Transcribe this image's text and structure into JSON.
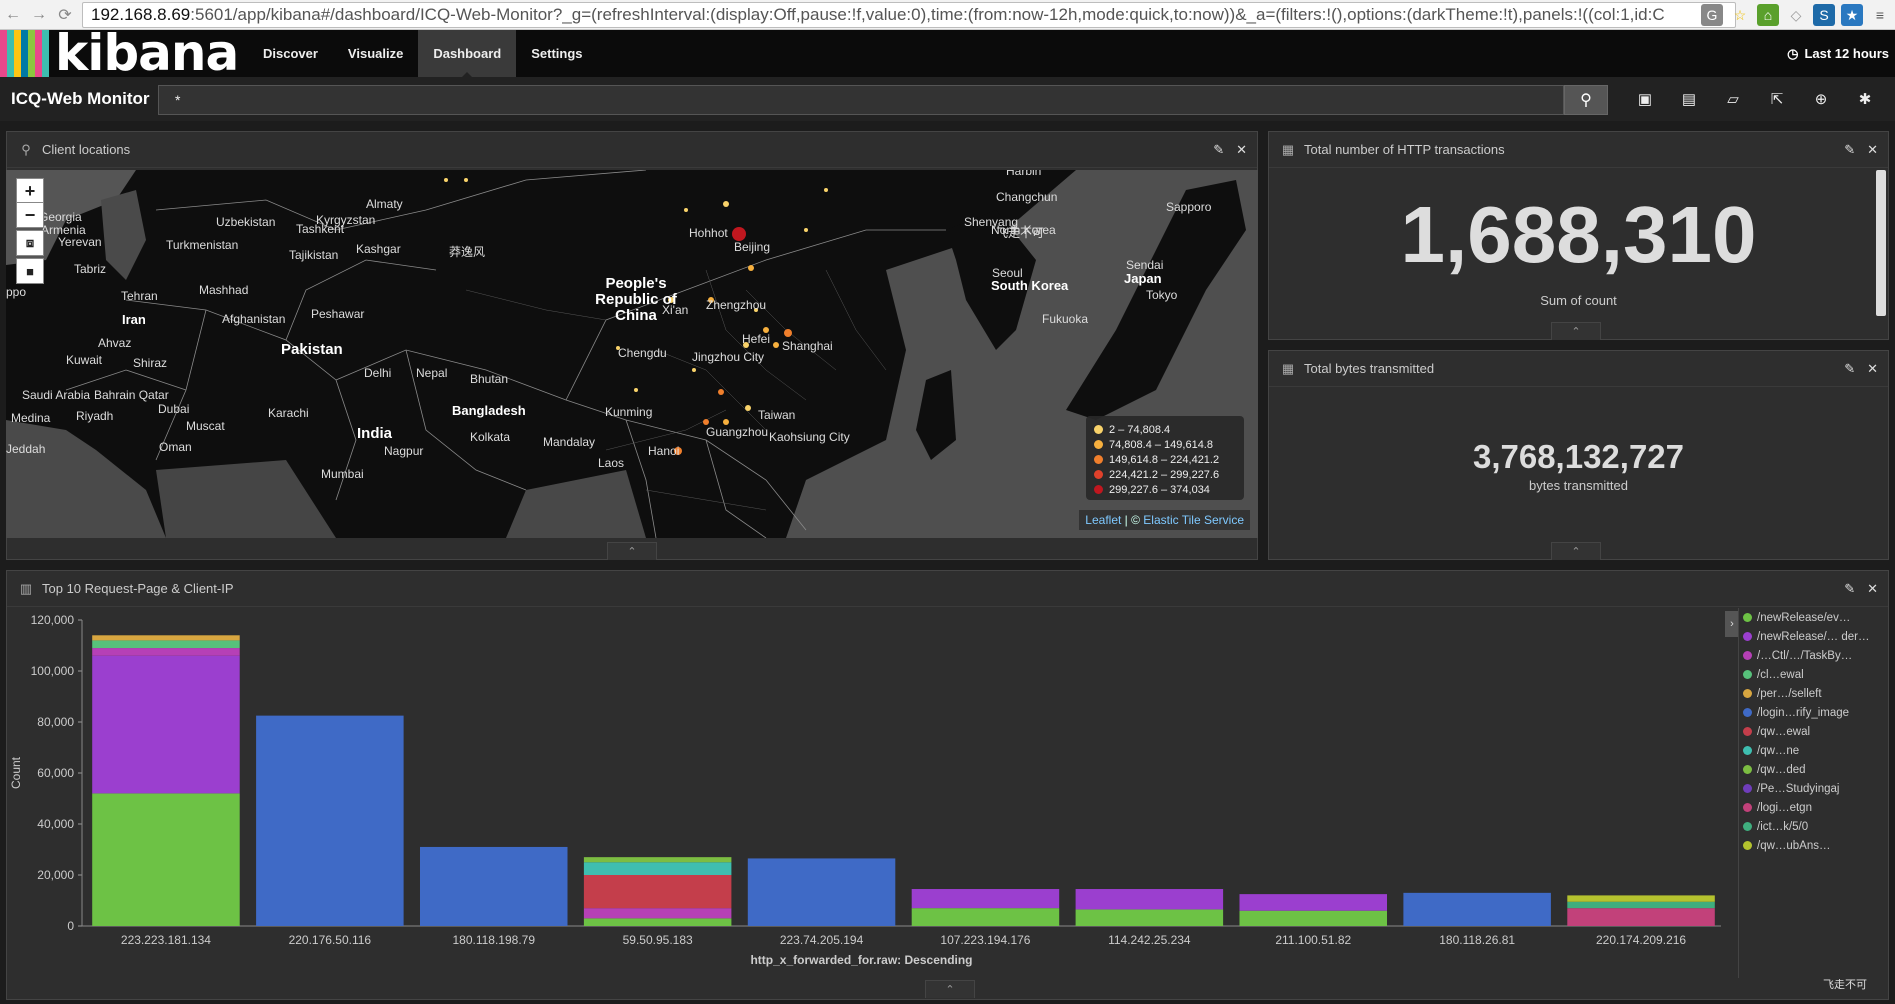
{
  "browser": {
    "url_host": "192.168.8.69",
    "url_rest": ":5601/app/kibana#/dashboard/ICQ-Web-Monitor?_g=(refreshInterval:(display:Off,pause:!f,value:0),time:(from:now-12h,mode:quick,to:now))&_a=(filters:!(),options:(darkTheme:!t),panels:!((col:1,id:C"
  },
  "nav": {
    "logo": "kibana",
    "logo_colors": [
      "#e8488b",
      "#3ebeb0",
      "#fec514",
      "#0079a5",
      "#8cc63f",
      "#e8488b",
      "#3ebeb0"
    ],
    "items": [
      {
        "label": "Discover"
      },
      {
        "label": "Visualize"
      },
      {
        "label": "Dashboard"
      },
      {
        "label": "Settings"
      }
    ],
    "active": "Dashboard",
    "time_range": "Last 12 hours"
  },
  "dashboard": {
    "title": "ICQ-Web Monitor",
    "query": "*"
  },
  "panels": {
    "map": {
      "title": "Client locations",
      "attribution_link": "Leaflet",
      "attribution_sep": " | © ",
      "attribution_service": "Elastic Tile Service",
      "legend": [
        {
          "label": "2 – 74,808.4",
          "color": "#f8d26a"
        },
        {
          "label": "74,808.4 – 149,614.8",
          "color": "#f7b03e"
        },
        {
          "label": "149,614.8 – 224,421.2",
          "color": "#f07f2c"
        },
        {
          "label": "224,421.2 – 299,227.6",
          "color": "#e0412b"
        },
        {
          "label": "299,227.6 – 374,034",
          "color": "#c0171f"
        }
      ],
      "places": [
        {
          "name": "Harbin",
          "cls": ""
        },
        {
          "name": "Almaty",
          "cls": ""
        },
        {
          "name": "Changchun",
          "cls": ""
        },
        {
          "name": "Georgia",
          "cls": ""
        },
        {
          "name": "Uzbekistan",
          "cls": ""
        },
        {
          "name": "Kyrgyzstan",
          "cls": ""
        },
        {
          "name": "Shenyang",
          "cls": ""
        },
        {
          "name": "Sapporo",
          "cls": ""
        },
        {
          "name": "Armenia",
          "cls": ""
        },
        {
          "name": "Tashkent",
          "cls": ""
        },
        {
          "name": "Hohhot",
          "cls": ""
        },
        {
          "name": "North Korea",
          "cls": ""
        },
        {
          "name": "Yerevan",
          "cls": ""
        },
        {
          "name": "Turkmenistan",
          "cls": ""
        },
        {
          "name": "Tajikistan",
          "cls": ""
        },
        {
          "name": "Kashgar",
          "cls": ""
        },
        {
          "name": "Beijing",
          "cls": ""
        },
        {
          "name": "飞走不可",
          "cls": ""
        },
        {
          "name": "Tabriz",
          "cls": ""
        },
        {
          "name": "Seoul",
          "cls": ""
        },
        {
          "name": "Sendai",
          "cls": ""
        },
        {
          "name": "People's Republic of China",
          "cls": "big"
        },
        {
          "name": "Japan",
          "cls": "mid"
        },
        {
          "name": "Tehran",
          "cls": ""
        },
        {
          "name": "Mashhad",
          "cls": ""
        },
        {
          "name": "South Korea",
          "cls": "mid"
        },
        {
          "name": "Tokyo",
          "cls": ""
        },
        {
          "name": "Zhengzhou",
          "cls": ""
        },
        {
          "name": "Iran",
          "cls": "mid"
        },
        {
          "name": "Afghanistan",
          "cls": ""
        },
        {
          "name": "Peshawar",
          "cls": ""
        },
        {
          "name": "Xi'an",
          "cls": ""
        },
        {
          "name": "Fukuoka",
          "cls": ""
        },
        {
          "name": "Hefei",
          "cls": ""
        },
        {
          "name": "Pakistan",
          "cls": "big"
        },
        {
          "name": "Shanghai",
          "cls": ""
        },
        {
          "name": "Kuwait",
          "cls": ""
        },
        {
          "name": "Ahvaz",
          "cls": ""
        },
        {
          "name": "Chengdu",
          "cls": ""
        },
        {
          "name": "Jingzhou City",
          "cls": ""
        },
        {
          "name": "Shiraz",
          "cls": ""
        },
        {
          "name": "Delhi",
          "cls": ""
        },
        {
          "name": "Nepal",
          "cls": ""
        },
        {
          "name": "Bhutan",
          "cls": ""
        },
        {
          "name": "Saudi Arabia",
          "cls": ""
        },
        {
          "name": "Bahrain Qatar",
          "cls": ""
        },
        {
          "name": "Kunming",
          "cls": ""
        },
        {
          "name": "Bangladesh",
          "cls": "mid"
        },
        {
          "name": "Taiwan",
          "cls": ""
        },
        {
          "name": "Medina",
          "cls": ""
        },
        {
          "name": "Riyadh",
          "cls": ""
        },
        {
          "name": "Dubai",
          "cls": ""
        },
        {
          "name": "Karachi",
          "cls": ""
        },
        {
          "name": "Muscat",
          "cls": ""
        },
        {
          "name": "India",
          "cls": "big"
        },
        {
          "name": "Guangzhou",
          "cls": ""
        },
        {
          "name": "Kaohsiung City",
          "cls": ""
        },
        {
          "name": "Oman",
          "cls": ""
        },
        {
          "name": "Kolkata",
          "cls": ""
        },
        {
          "name": "Mandalay",
          "cls": ""
        },
        {
          "name": "Jeddah",
          "cls": ""
        },
        {
          "name": "Nagpur",
          "cls": ""
        },
        {
          "name": "Laos",
          "cls": ""
        },
        {
          "name": "Hanoi",
          "cls": ""
        },
        {
          "name": "Mumbai",
          "cls": ""
        },
        {
          "name": "ppo",
          "cls": ""
        },
        {
          "name": "莽逸风",
          "cls": ""
        }
      ]
    },
    "http": {
      "title": "Total number of HTTP transactions",
      "value": "1,688,310",
      "label": "Sum of count"
    },
    "bytes": {
      "title": "Total bytes transmitted",
      "value": "3,768,132,727",
      "label": "bytes transmitted"
    },
    "top10": {
      "title": "Top 10 Request-Page & Client-IP",
      "legend": [
        {
          "label": "/newRelease/ev…",
          "color": "#6dc245"
        },
        {
          "label": "/newRelease/… der…",
          "color": "#9b3fcf"
        },
        {
          "label": "/…Ctl/…/TaskBy…",
          "color": "#b640b6"
        },
        {
          "label": "/cl…ewal",
          "color": "#57c17b"
        },
        {
          "label": "/per…/selleft",
          "color": "#d8a640"
        },
        {
          "label": "/login…rify_image",
          "color": "#3f6ac6"
        },
        {
          "label": "/qw…ewal",
          "color": "#c43e4b"
        },
        {
          "label": "/qw…ne",
          "color": "#3ebeb0"
        },
        {
          "label": "/qw…ded",
          "color": "#7cbd42"
        },
        {
          "label": "/Pe…Studyingaj",
          "color": "#6f3dbb"
        },
        {
          "label": "/logi…etgn",
          "color": "#c2417a"
        },
        {
          "label": "/ict…k/5/0",
          "color": "#3fae7e"
        },
        {
          "label": "/qw…ubAns…",
          "color": "#b4c22e"
        }
      ]
    }
  },
  "chart_data": {
    "type": "bar",
    "stacked": true,
    "xlabel": "http_x_forwarded_for.raw: Descending",
    "ylabel": "Count",
    "ylim": [
      0,
      120000
    ],
    "yticks": [
      "0",
      "20,000",
      "40,000",
      "60,000",
      "80,000",
      "100,000",
      "120,000"
    ],
    "categories": [
      "223.223.181.134",
      "220.176.50.116",
      "180.118.198.79",
      "59.50.95.183",
      "223.74.205.194",
      "107.223.194.176",
      "114.242.25.234",
      "211.100.51.82",
      "180.118.26.81",
      "220.174.209.216"
    ],
    "stacks": [
      [
        {
          "value": 52000,
          "color": "#6dc245"
        },
        {
          "value": 54000,
          "color": "#9b3fcf"
        },
        {
          "value": 3000,
          "color": "#b640b6"
        },
        {
          "value": 3000,
          "color": "#57c17b"
        },
        {
          "value": 2000,
          "color": "#d8a640"
        }
      ],
      [
        {
          "value": 82500,
          "color": "#3f6ac6"
        }
      ],
      [
        {
          "value": 31000,
          "color": "#3f6ac6"
        }
      ],
      [
        {
          "value": 3000,
          "color": "#6dc245"
        },
        {
          "value": 4000,
          "color": "#b640b6"
        },
        {
          "value": 13000,
          "color": "#c43e4b"
        },
        {
          "value": 5000,
          "color": "#3ebeb0"
        },
        {
          "value": 2000,
          "color": "#7cbd42"
        }
      ],
      [
        {
          "value": 26500,
          "color": "#3f6ac6"
        }
      ],
      [
        {
          "value": 7000,
          "color": "#6dc245"
        },
        {
          "value": 7500,
          "color": "#9b3fcf"
        }
      ],
      [
        {
          "value": 6500,
          "color": "#6dc245"
        },
        {
          "value": 8000,
          "color": "#9b3fcf"
        }
      ],
      [
        {
          "value": 6000,
          "color": "#6dc245"
        },
        {
          "value": 6500,
          "color": "#9b3fcf"
        }
      ],
      [
        {
          "value": 13000,
          "color": "#3f6ac6"
        }
      ],
      [
        {
          "value": 7000,
          "color": "#c2417a"
        },
        {
          "value": 2500,
          "color": "#3fae7e"
        },
        {
          "value": 2500,
          "color": "#b4c22e"
        }
      ]
    ]
  },
  "footer_mark": "飞走不可"
}
